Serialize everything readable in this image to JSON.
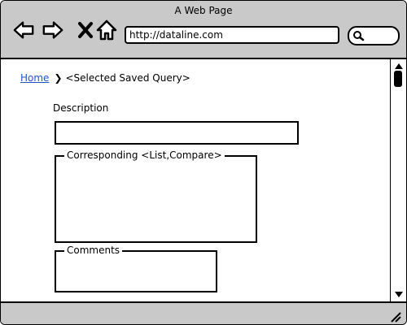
{
  "window": {
    "title": "A Web Page"
  },
  "address_bar": {
    "url": "http://dataline.com"
  },
  "icons": {
    "back": "back-arrow-icon",
    "forward": "forward-arrow-icon",
    "stop": "close-x-icon",
    "home": "home-icon",
    "search": "search-icon"
  },
  "breadcrumb": {
    "home_label": "Home",
    "separator": "❯",
    "current": "<Selected Saved Query>"
  },
  "form": {
    "description_label": "Description",
    "description_value": "",
    "corresponding_legend": "Corresponding <List,Compare>",
    "comments_legend": "Comments"
  },
  "colors": {
    "chrome": "#c9c9c9",
    "link": "#2255cc"
  }
}
